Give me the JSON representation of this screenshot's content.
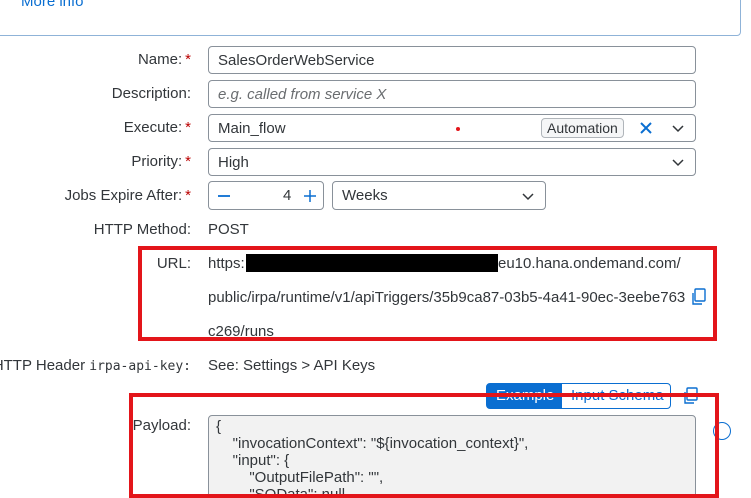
{
  "info": {
    "more_info": "More info"
  },
  "form": {
    "name": {
      "label": "Name:",
      "value": "SalesOrderWebService",
      "required": true
    },
    "description": {
      "label": "Description:",
      "placeholder": "e.g. called from service X"
    },
    "execute": {
      "label": "Execute:",
      "value": "Main_flow",
      "tag": "Automation"
    },
    "priority": {
      "label": "Priority:",
      "value": "High"
    },
    "jobs_expire": {
      "label": "Jobs Expire After:",
      "value": "4",
      "unit": "Weeks"
    },
    "http_method": {
      "label": "HTTP Method:",
      "value": "POST"
    },
    "url": {
      "label": "URL:",
      "line1_prefix": "https:",
      "line1_suffix": "eu10.hana.ondemand.com/",
      "line2": "public/irpa/runtime/v1/apiTriggers/35b9ca87-03b5-4a41-90ec-3eebe763",
      "line3": "c269/runs"
    },
    "http_header": {
      "label_prefix": "HTTP Header",
      "label_code": "irpa-api-key:",
      "value": "See: Settings > API Keys"
    },
    "payload": {
      "label": "Payload:",
      "tabs": [
        "Example",
        "Input Schema"
      ],
      "lines": [
        "{",
        "    \"invocationContext\": \"${invocation_context}\",",
        "    \"input\": {",
        "        \"OutputFilePath\": \"\",",
        "        \"SOData\": null"
      ]
    }
  },
  "icons": {
    "clear": "x-icon",
    "dropdown": "chevron-down-icon",
    "copy": "copy-icon",
    "minus": "minus-icon",
    "plus": "plus-icon"
  },
  "colors": {
    "accent": "#0a6ed1",
    "required": "#bb0000",
    "highlight": "#e3151a"
  }
}
